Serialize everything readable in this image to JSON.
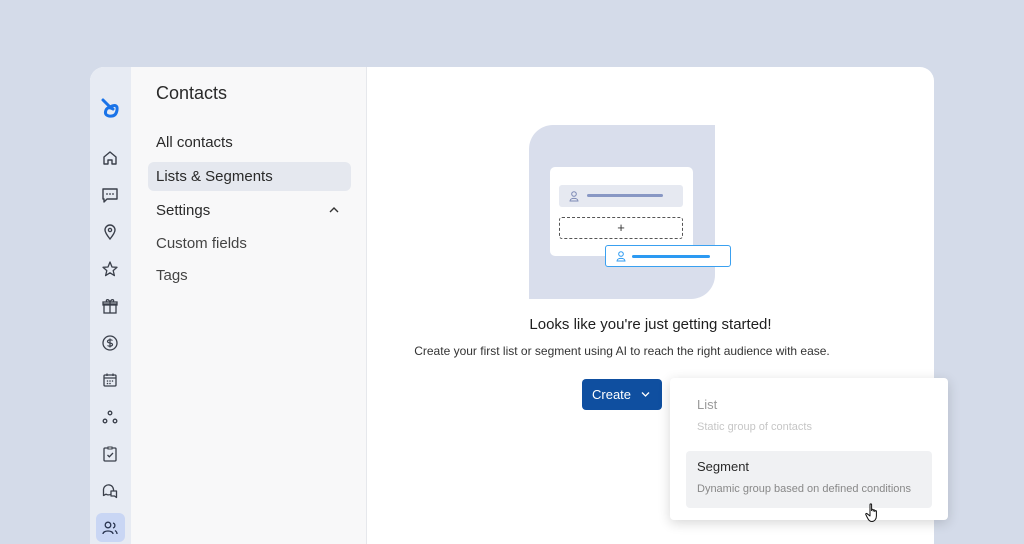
{
  "sidebar": {
    "title": "Contacts",
    "items": [
      {
        "label": "All contacts"
      },
      {
        "label": "Lists & Segments"
      },
      {
        "label": "Settings"
      },
      {
        "label": "Custom fields"
      },
      {
        "label": "Tags"
      }
    ]
  },
  "rail": {
    "icons": [
      "home-icon",
      "chat-icon",
      "location-pin-icon",
      "star-icon",
      "gift-icon",
      "dollar-icon",
      "calendar-icon",
      "nodes-icon",
      "checklist-icon",
      "messages-icon",
      "contacts-icon"
    ],
    "active": "contacts-icon"
  },
  "empty_state": {
    "headline": "Looks like you're just getting started!",
    "subline": "Create your first list or segment using AI to reach the right audience with ease.",
    "add_symbol": "+"
  },
  "create_button": {
    "label": "Create"
  },
  "dropdown": {
    "items": [
      {
        "title": "List",
        "description": "Static group of contacts",
        "state": "disabled"
      },
      {
        "title": "Segment",
        "description": "Dynamic group based on defined conditions",
        "state": "hover"
      }
    ]
  },
  "colors": {
    "background": "#d4dbe9",
    "accent": "#0f4fa0",
    "highlight": "#2c9af2",
    "logo": "#1a73e8"
  }
}
